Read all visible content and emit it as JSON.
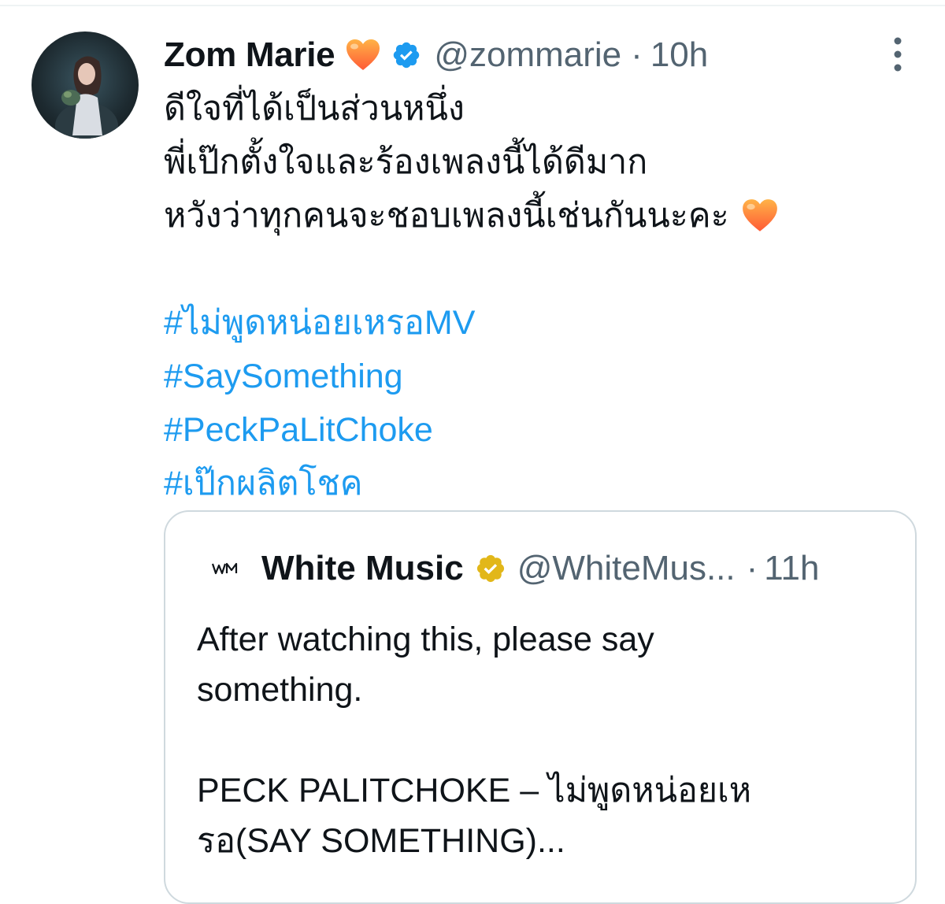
{
  "tweet": {
    "author": {
      "display_name": "Zom Marie",
      "handle": "@zommarie",
      "verified_color": "#1d9bf0"
    },
    "separator": "·",
    "time": "10h",
    "text_lines": [
      "ดีใจที่ได้เป็นส่วนหนึ่ง",
      "พี่เป๊กตั้งใจและร้องเพลงนี้ได้ดีมาก",
      "หวังว่าทุกคนจะชอบเพลงนี้เช่นกันนะคะ"
    ],
    "hashtags": [
      "#ไม่พูดหน่อยเหรอMV",
      "#SaySomething",
      "#PeckPaLitChoke",
      "#เป๊กผลิตโชค"
    ]
  },
  "quoted_tweet": {
    "author": {
      "display_name": "White Music",
      "handle": "@WhiteMus...",
      "verified_color": "#e2b719"
    },
    "separator": "·",
    "time": "11h",
    "text_lines": [
      "After watching this, please say",
      "something.",
      "",
      "PECK PALITCHOKE – ไม่พูดหน่อยเห",
      "รอ(SAY SOMETHING)..."
    ]
  },
  "icons": {
    "heart": "orange-heart-emoji",
    "verified": "verified-badge-icon",
    "more": "more-options-icon",
    "logo": "white-music-logo"
  },
  "colors": {
    "link": "#1d9bf0",
    "secondary_text": "#536471",
    "border": "#cfd9de",
    "heart_top": "#ffb347",
    "heart_bottom": "#ff5a36"
  }
}
